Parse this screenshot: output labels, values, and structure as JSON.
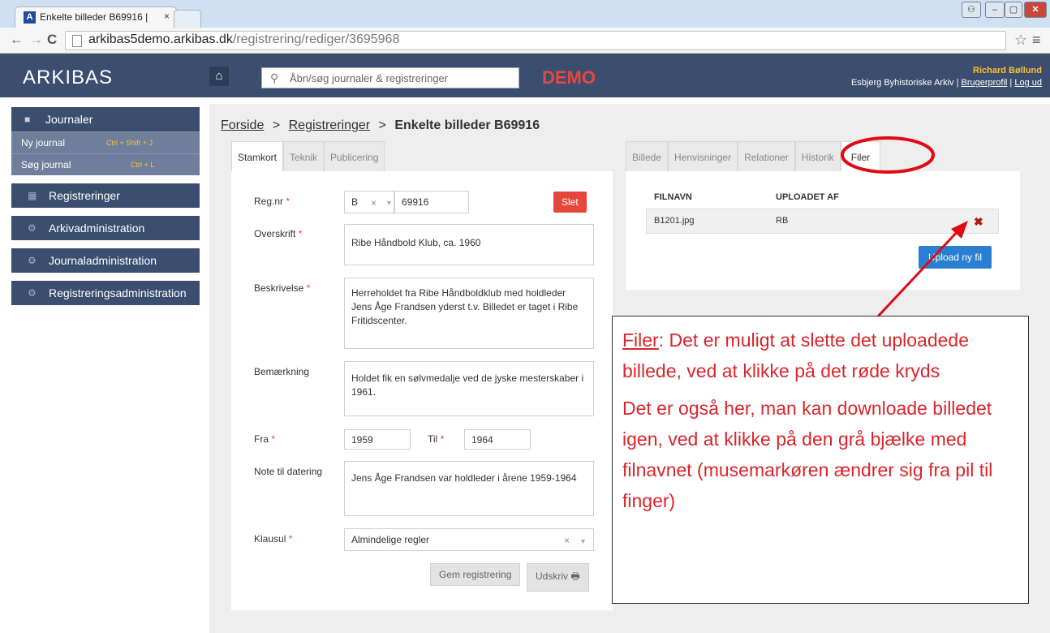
{
  "browser": {
    "tab_title": "Enkelte billeder B69916 | ",
    "tab_close": "×",
    "favicon": "A",
    "url_domain": "arkibas5demo.arkibas.dk",
    "url_path": "/registrering/rediger/3695968",
    "back": "←",
    "forward": "→",
    "reload": "C",
    "star": "☆",
    "menu": "≡"
  },
  "header": {
    "logo": "ARKIBAS",
    "home_icon": "home-icon",
    "search_placeholder": "Åbn/søg journaler & registreringer",
    "demo": "DEMO",
    "user_name": "Richard Bøllund",
    "archive": "Esbjerg Byhistoriske Arkiv",
    "profile": "Brugerprofil",
    "logout": "Log ud"
  },
  "sidebar": {
    "journaler": "Journaler",
    "ny_journal": "Ny journal",
    "ny_journal_shortcut": "Ctrl + Shift + J",
    "sog_journal": "Søg journal",
    "sog_journal_shortcut": "Ctrl + L",
    "items": [
      "Registreringer",
      "Arkivadministration",
      "Journaladministration",
      "Registreringsadministration"
    ]
  },
  "breadcrumb": {
    "home": "Forside",
    "sep": ">",
    "registreringer": "Registreringer",
    "current": "Enkelte billeder B69916"
  },
  "left_tabs": [
    "Stamkort",
    "Teknik",
    "Publicering"
  ],
  "form": {
    "regnr_label": "Reg.nr",
    "regnr_prefix": "B",
    "regnr_number": "69916",
    "delete_button": "Slet",
    "overskrift_label": "Overskrift",
    "overskrift": "Ribe Håndbold Klub, ca. 1960",
    "beskrivelse_label": "Beskrivelse",
    "beskrivelse": "Herreholdet fra Ribe Håndboldklub med holdleder Jens Åge Frandsen yderst t.v. Billedet er taget i Ribe Fritidscenter.",
    "bemaerkning_label": "Bemærkning",
    "bemaerkning": "Holdet fik en sølvmedalje ved de jyske mesterskaber i 1961.",
    "fra_label": "Fra",
    "fra": "1959",
    "til_label": "Til",
    "til": "1964",
    "note_label": "Note til datering",
    "note": "Jens Åge Frandsen var holdleder i årene 1959-1964",
    "klausul_label": "Klausul",
    "klausul": "Almindelige regler",
    "required_mark": "*",
    "save_button": "Gem registrering",
    "print_button": "Udskriv"
  },
  "right_tabs": [
    "Billede",
    "Henvisninger",
    "Relationer",
    "Historik",
    "Filer"
  ],
  "files": {
    "col_name": "FILNAVN",
    "col_uploader": "UPLOADET AF",
    "rows": [
      {
        "name": "B1201.jpg",
        "uploader": "RB",
        "delete": "✖"
      }
    ],
    "upload_button": "Upload ny fil"
  },
  "callout": {
    "title": "Filer",
    "p1_rest": ": Det er muligt at slette det uploadede billede, ved at klikke på det røde kryds",
    "p2": "Det er også her, man kan downloade billedet igen, ved at klikke på den grå bjælke med filnavnet (musemarkøren ændrer sig fra pil til finger)"
  },
  "colors": {
    "header": "#3b4e6f",
    "accent_red": "#e7463c",
    "primary_blue": "#2a7fd1",
    "annotation_red": "#d9252b"
  }
}
